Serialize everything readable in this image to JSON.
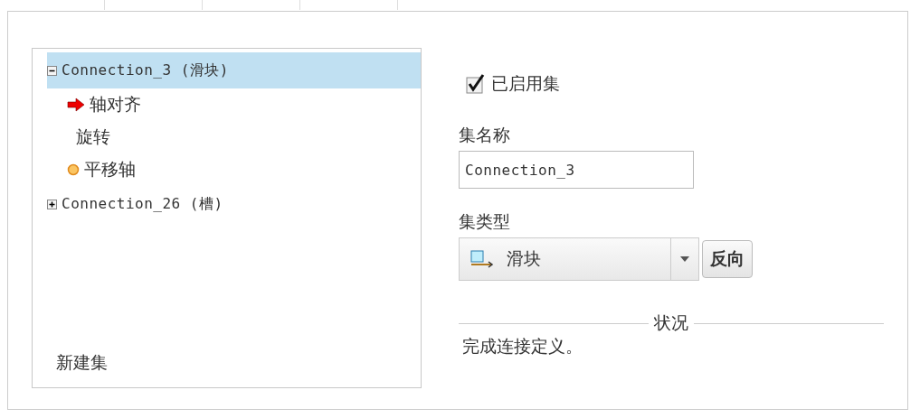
{
  "tree": {
    "items": [
      {
        "label": "Connection_3 (滑块)",
        "expanded": true,
        "selected": true,
        "children": [
          {
            "label": "轴对齐",
            "kind": "arrow"
          },
          {
            "label": "旋转",
            "kind": "plain"
          },
          {
            "label": "平移轴",
            "kind": "dot"
          }
        ]
      },
      {
        "label": "Connection_26 (槽)",
        "expanded": false,
        "selected": false
      }
    ],
    "new_set": "新建集"
  },
  "enabled": {
    "label": "已启用集",
    "checked": true
  },
  "set_name": {
    "label": "集名称",
    "value": "Connection_3"
  },
  "set_type": {
    "label": "集类型",
    "value": "滑块",
    "button": "反向"
  },
  "status": {
    "title": "状况",
    "message": "完成连接定义。"
  }
}
